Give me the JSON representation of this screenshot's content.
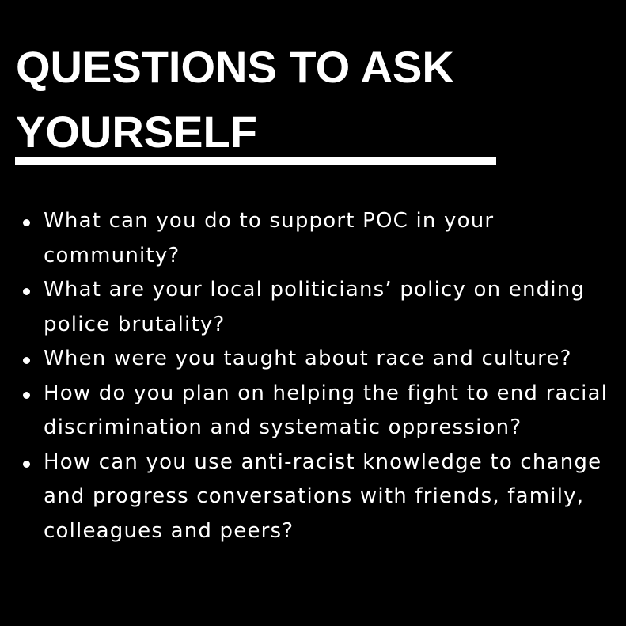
{
  "title": {
    "line1": "QUESTIONS TO ASK",
    "line2": "YOURSELF"
  },
  "questions": [
    "What can you do to support POC in your community?",
    "What are your local politicians’ policy on ending police brutality?",
    "When were you taught about race and culture?",
    "How do you plan on helping the fight to end racial discrimination and systematic oppression?",
    "How can you use anti-racist knowledge to change and progress conversations with friends, family, colleagues and peers?"
  ],
  "colors": {
    "background": "#000000",
    "text": "#ffffff"
  }
}
